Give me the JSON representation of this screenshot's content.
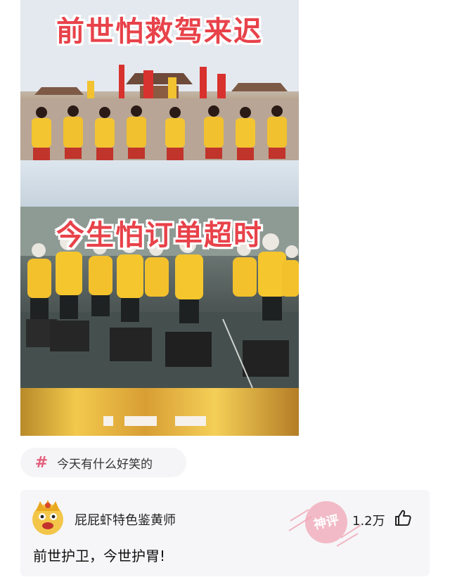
{
  "meme": {
    "caption_top": "前世怕救驾来迟",
    "caption_bottom": "今生怕订单超时"
  },
  "topic_tag": {
    "icon": "hash-icon",
    "label": "今天有什么好笑的"
  },
  "comment": {
    "username": "屁屁虾特色鉴黄师",
    "likes": "1.2万",
    "text": "前世护卫，今世护胃!",
    "badge_text": "神评",
    "colors": {
      "accent": "#e35f7c",
      "badge": "#f0a5b5"
    }
  }
}
